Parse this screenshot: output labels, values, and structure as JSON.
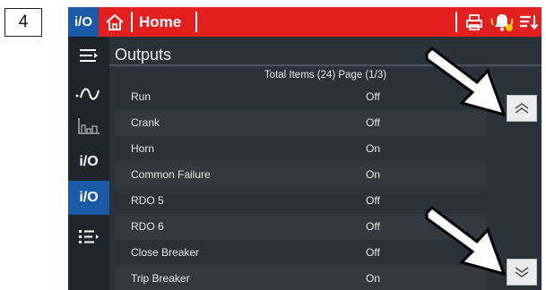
{
  "step_number": "4",
  "topbar": {
    "io_badge": "i/O",
    "title": "Home",
    "icons": [
      "home-icon",
      "printer-icon",
      "alarm-bell-icon",
      "sort-menu-icon"
    ]
  },
  "sidebar": {
    "items": [
      {
        "icon": "menu-expand-icon"
      },
      {
        "icon": "ac-waveform-icon"
      },
      {
        "icon": "bar-chart-icon"
      },
      {
        "icon": "io-icon",
        "label": "i/O"
      },
      {
        "icon": "io-icon",
        "label": "i/O",
        "active": true
      },
      {
        "icon": "list-menu-icon"
      }
    ]
  },
  "main": {
    "title": "Outputs",
    "summary": "Total Items (24) Page (1/3)",
    "rows": [
      {
        "name": "Run",
        "state": "Off"
      },
      {
        "name": "Crank",
        "state": "Off"
      },
      {
        "name": "Horn",
        "state": "On"
      },
      {
        "name": "Common Failure",
        "state": "On"
      },
      {
        "name": "RDO 5",
        "state": "Off"
      },
      {
        "name": "RDO 6",
        "state": "Off"
      },
      {
        "name": "Close Breaker",
        "state": "Off"
      },
      {
        "name": "Trip Breaker",
        "state": "On"
      }
    ],
    "scroll_up_icon": "chevron-double-up-icon",
    "scroll_down_icon": "chevron-double-down-icon"
  },
  "colors": {
    "topbar": "#e31f1f",
    "active_blue": "#1a5aa6",
    "background": "#2b333a",
    "sidebar": "#1f262b"
  }
}
